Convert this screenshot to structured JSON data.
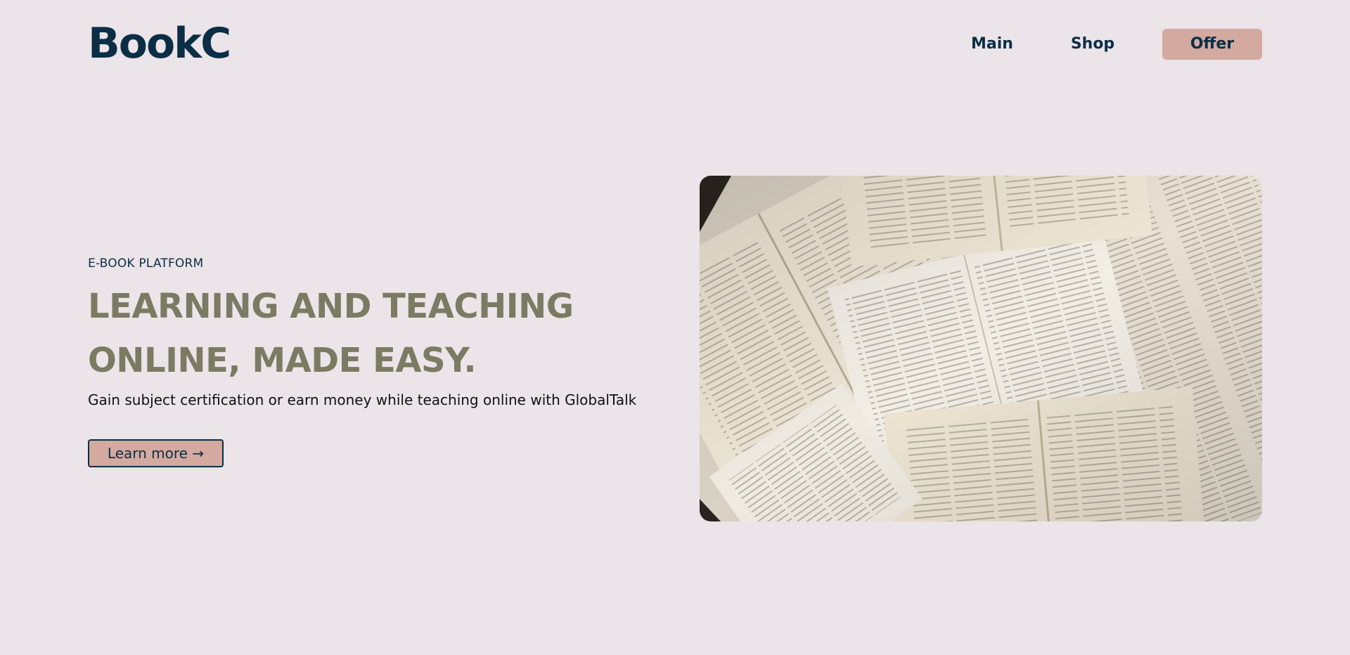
{
  "brand": {
    "logo_text": "BookC"
  },
  "nav": {
    "items": [
      {
        "label": "Main"
      },
      {
        "label": "Shop"
      },
      {
        "label": "Offer"
      }
    ]
  },
  "hero": {
    "eyebrow": "E-BOOK PLATFORM",
    "headline_line1": "LEARNING AND TEACHING",
    "headline_line2": "ONLINE, MADE EASY.",
    "subtext": "Gain subject certification or earn money while teaching online with GlobalTalk",
    "cta_label": "Learn more →",
    "image_subject": "open-books-photo"
  },
  "colors": {
    "background": "#ebe4e8",
    "brand_navy": "#0b2e46",
    "accent_pink": "#d4a99f",
    "headline_olive": "#7a7b62"
  }
}
